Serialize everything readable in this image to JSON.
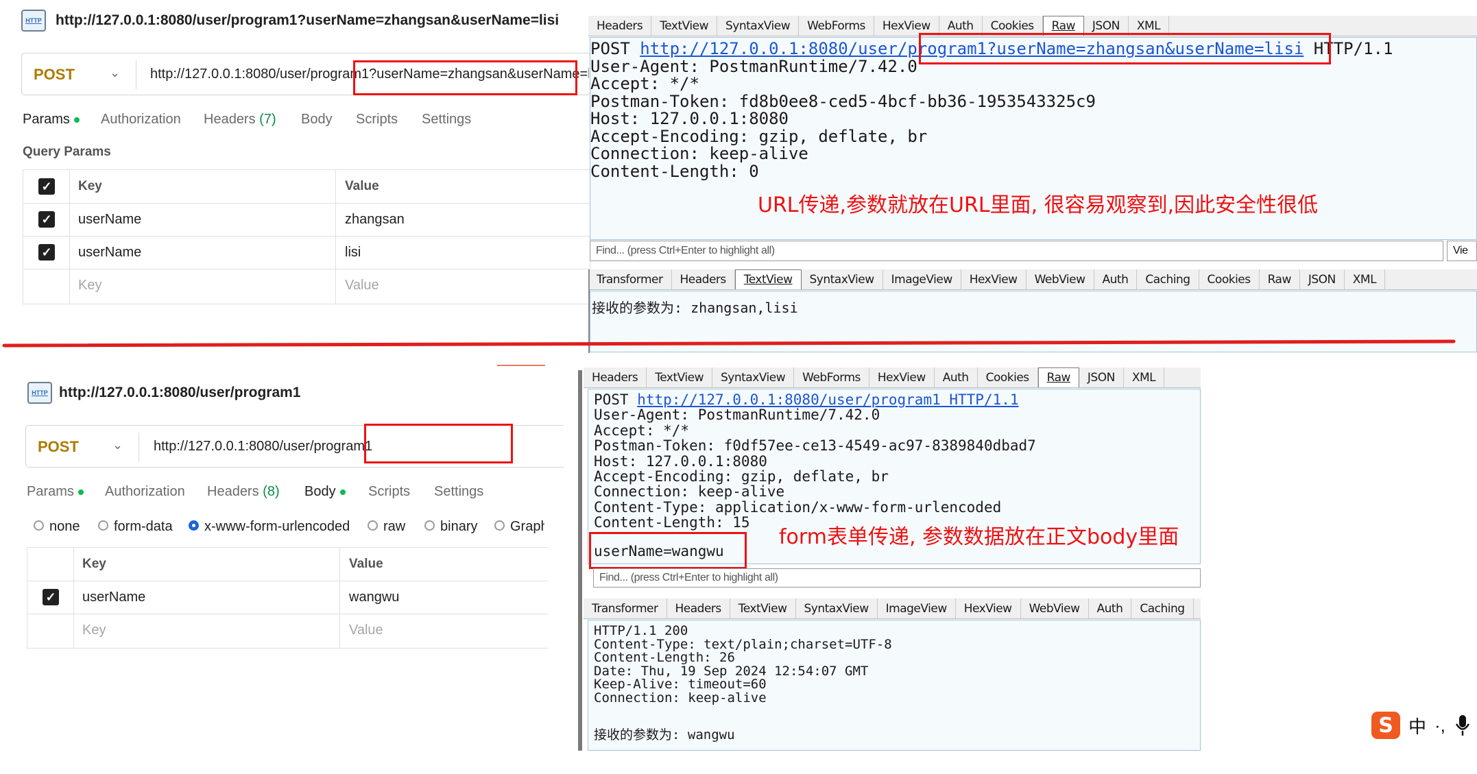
{
  "top": {
    "postman": {
      "title": "http://127.0.0.1:8080/user/program1?userName=zhangsan&userName=lisi",
      "method": "POST",
      "url": "http://127.0.0.1:8080/user/program1?userName=zhangsan&userName=lisi",
      "tabs": {
        "params": "Params",
        "authorization": "Authorization",
        "headers": "Headers",
        "headers_count": "(7)",
        "body": "Body",
        "scripts": "Scripts",
        "settings": "Settings"
      },
      "section": "Query Params",
      "table": {
        "key_header": "Key",
        "value_header": "Value",
        "rows": [
          {
            "key": "userName",
            "value": "zhangsan"
          },
          {
            "key": "userName",
            "value": "lisi"
          }
        ],
        "placeholder_key": "Key",
        "placeholder_value": "Value"
      }
    },
    "fiddler": {
      "request_tabs": [
        "Headers",
        "TextView",
        "SyntaxView",
        "WebForms",
        "HexView",
        "Auth",
        "Cookies",
        "Raw",
        "JSON",
        "XML"
      ],
      "request_method": "POST ",
      "request_url": "http://127.0.0.1:8080/user/program1?userName=zhangsan&userName=lisi",
      "request_protocol": " HTTP/1.1",
      "request_lines": [
        "User-Agent: PostmanRuntime/7.42.0",
        "Accept: */*",
        "Postman-Token: fd8b0ee8-ced5-4bcf-bb36-1953543325c9",
        "Host: 127.0.0.1:8080",
        "Accept-Encoding: gzip, deflate, br",
        "Connection: keep-alive",
        "Content-Length: 0"
      ],
      "annotation": "URL传递,参数就放在URL里面, 很容易观察到,因此安全性很低",
      "find_placeholder": "Find... (press Ctrl+Enter to highlight all)",
      "view_button": "Vie",
      "response_tabs": [
        "Transformer",
        "Headers",
        "TextView",
        "SyntaxView",
        "ImageView",
        "HexView",
        "WebView",
        "Auth",
        "Caching",
        "Cookies",
        "Raw",
        "JSON",
        "XML"
      ],
      "response_body": "接收的参数为: zhangsan,lisi"
    }
  },
  "bottom": {
    "postman": {
      "title": "http://127.0.0.1:8080/user/program1",
      "method": "POST",
      "url": "http://127.0.0.1:8080/user/program1",
      "tabs": {
        "params": "Params",
        "authorization": "Authorization",
        "headers": "Headers",
        "headers_count": "(8)",
        "body": "Body",
        "scripts": "Scripts",
        "settings": "Settings"
      },
      "body_types": [
        "none",
        "form-data",
        "x-www-form-urlencoded",
        "raw",
        "binary",
        "Graph"
      ],
      "selected_body_type": "x-www-form-urlencoded",
      "table": {
        "key_header": "Key",
        "value_header": "Value",
        "rows": [
          {
            "key": "userName",
            "value": "wangwu"
          }
        ],
        "placeholder_key": "Key",
        "placeholder_value": "Value"
      }
    },
    "fiddler": {
      "request_tabs": [
        "Headers",
        "TextView",
        "SyntaxView",
        "WebForms",
        "HexView",
        "Auth",
        "Cookies",
        "Raw",
        "JSON",
        "XML"
      ],
      "request_method": "POST ",
      "request_url": "http://127.0.0.1:8080/user/program1 HTTP/1.1",
      "request_lines": [
        "User-Agent: PostmanRuntime/7.42.0",
        "Accept: */*",
        "Postman-Token: f0df57ee-ce13-4549-ac97-8389840dbad7",
        "Host: 127.0.0.1:8080",
        "Accept-Encoding: gzip, deflate, br",
        "Connection: keep-alive",
        "Content-Type: application/x-www-form-urlencoded",
        "Content-Length: 15"
      ],
      "request_body": "userName=wangwu",
      "annotation": "form表单传递, 参数数据放在正文body里面",
      "find_placeholder": "Find... (press Ctrl+Enter to highlight all)",
      "response_tabs": [
        "Transformer",
        "Headers",
        "TextView",
        "SyntaxView",
        "ImageView",
        "HexView",
        "WebView",
        "Auth",
        "Caching"
      ],
      "response_lines": [
        "HTTP/1.1 200",
        "Content-Type: text/plain;charset=UTF-8",
        "Content-Length: 26",
        "Date: Thu, 19 Sep 2024 12:54:07 GMT",
        "Keep-Alive: timeout=60",
        "Connection: keep-alive"
      ],
      "response_body": "接收的参数为: wangwu"
    }
  },
  "ime": {
    "logo": "S",
    "lang": "中",
    "punct": "·,"
  },
  "colors": {
    "annotation_red": "#ee1111",
    "method_orange": "#ad7a03",
    "link_blue": "#1a56d6",
    "active_green": "#0cbb52"
  }
}
